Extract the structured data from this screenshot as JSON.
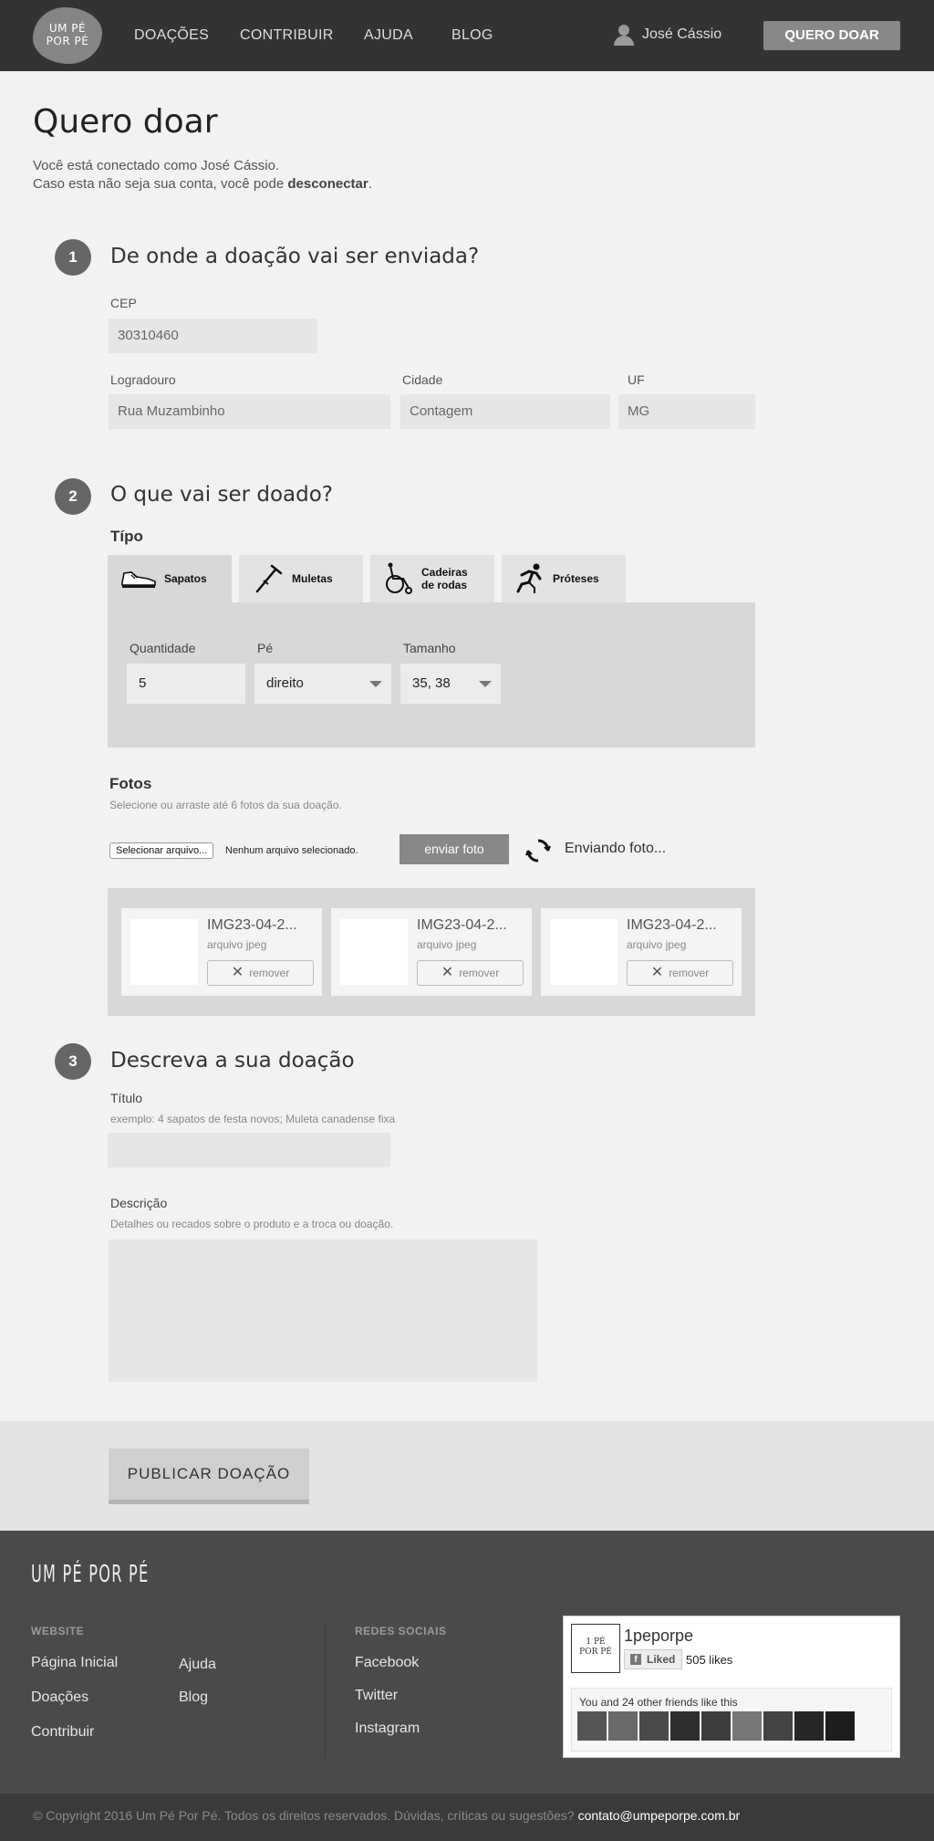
{
  "header": {
    "logo_lines": [
      "UM PÉ",
      "POR PÉ"
    ],
    "nav": [
      "DOAÇÕES",
      "CONTRIBUIR",
      "AJUDA",
      "BLOG"
    ],
    "user_name": "José Cássio",
    "cta_label": "QUERO DOAR",
    "user_icon": "user-icon"
  },
  "page": {
    "title": "Quero doar",
    "intro_line1": "Você está conectado como José Cássio.",
    "intro_line2_prefix": "Caso esta não seja sua conta, você pode ",
    "intro_line2_link": "desconectar",
    "intro_line2_suffix": "."
  },
  "step1": {
    "number": "1",
    "title": "De onde a doação vai ser enviada?",
    "cep_label": "CEP",
    "cep_value": "30310460",
    "logradouro_label": "Logradouro",
    "logradouro_value": "Rua Muzambinho",
    "cidade_label": "Cidade",
    "cidade_value": "Contagem",
    "uf_label": "UF",
    "uf_value": "MG"
  },
  "step2": {
    "number": "2",
    "title": "O que vai ser doado?",
    "tipo_label": "Típo",
    "tabs": [
      {
        "label": "Sapatos",
        "icon": "shoe-icon",
        "active": true
      },
      {
        "label": "Muletas",
        "icon": "crutch-icon",
        "active": false
      },
      {
        "label_line1": "Cadeiras",
        "label_line2": "de rodas",
        "icon": "wheelchair-icon",
        "active": false
      },
      {
        "label": "Próteses",
        "icon": "prosthesis-runner-icon",
        "active": false
      }
    ],
    "quantidade_label": "Quantidade",
    "quantidade_value": "5",
    "pe_label": "Pé",
    "pe_value": "direito",
    "tamanho_label": "Tamanho",
    "tamanho_value": "35, 38",
    "fotos_label": "Fotos",
    "fotos_hint": "Selecione ou arraste até 6 fotos da sua doação.",
    "file_button": "Selecionar arquivo...",
    "file_status": "Nenhum arquivo selecionado.",
    "send_button": "enviar foto",
    "sending_text": "Enviando foto...",
    "photos": [
      {
        "name": "IMG23-04-2...",
        "type": "arquivo jpeg",
        "remove": "remover"
      },
      {
        "name": "IMG23-04-2...",
        "type": "arquivo jpeg",
        "remove": "remover"
      },
      {
        "name": "IMG23-04-2...",
        "type": "arquivo jpeg",
        "remove": "remover"
      }
    ]
  },
  "step3": {
    "number": "3",
    "title": "Descreva a sua doação",
    "titulo_label": "Título",
    "titulo_hint": "exemplo: 4 sapatos de festa novos; Muleta canadense fixa",
    "titulo_value": "",
    "descricao_label": "Descrição",
    "descricao_hint": "Detalhes ou recados sobre o produto e a troca ou doação.",
    "descricao_value": ""
  },
  "publish_label": "PUBLICAR DOAÇÃO",
  "footer": {
    "logo": "UM PÉ POR PÉ",
    "website_heading": "WEBSITE",
    "website_links": [
      "Página Inicial",
      "Doações",
      "Contribuir",
      "Ajuda",
      "Blog"
    ],
    "social_heading": "REDES SOCIAIS",
    "social_links": [
      "Facebook",
      "Twitter",
      "Instagram"
    ],
    "fb_logo_lines": [
      "1 PÉ",
      "POR PÉ"
    ],
    "fb_page_name": "1peporpe",
    "fb_liked": "Liked",
    "fb_likes": "505 likes",
    "fb_friends_text": "You and 24 other friends like this",
    "copyright": "© Copyright 2016 Um Pé Por Pé. Todos os direitos reservados. Dúvidas, críticas ou sugestões? ",
    "email": "contato@umpeporpe.com.br"
  },
  "colors": {
    "header_bg": "#333333",
    "footer_bg": "#4a4a4a",
    "accent_button": "#888888",
    "page_bg": "#f2f2f2"
  }
}
